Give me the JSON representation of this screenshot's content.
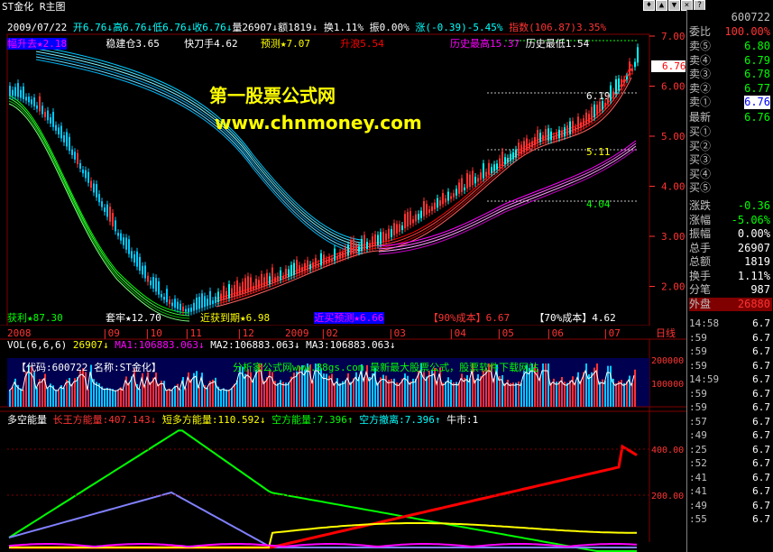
{
  "window": {
    "title": "ST金化  R主图",
    "controls": [
      "♦",
      "▲",
      "▼",
      "×",
      "?"
    ]
  },
  "quote_line": {
    "date": "2009/07/22",
    "open": "开6.76↓",
    "high": "高6.76↓",
    "low": "低6.76↓",
    "close": "收6.76↓",
    "vol": "量26907↓",
    "amount": "额1819↓",
    "turnover": "换1.11%",
    "amplitude": "振0.00%",
    "change": "涨(-0.39)-5.45%",
    "index": "指数(106.87)3.35%"
  },
  "indicator_line": {
    "a": "稳建仓3.65",
    "b": "快刀手4.62",
    "c": "预测★7.07",
    "d": "升浪5.54",
    "e": "历史最高15.37",
    "f": "历史最低1.54",
    "left": "幅升去★2.18"
  },
  "watermark": {
    "line1": "第一股票公式网",
    "line2": "www.chnmoney.com"
  },
  "price_marks": {
    "m1": "6.19",
    "m2": "5.11",
    "m3": "4.04"
  },
  "price_axis": [
    "7.00",
    "6.00",
    "5.00",
    "4.00",
    "3.00",
    "2.00"
  ],
  "current_price_tag": "6.76",
  "bottom_legend": {
    "a": "获利★87.30",
    "b": "套牢★12.70",
    "c": "近获到期★6.98",
    "d": "近买预测★6.66",
    "e": "【90%成本】6.67",
    "f": "【70%成本】4.62"
  },
  "date_axis": {
    "labels": [
      "2008",
      "|09",
      "|10",
      "|11",
      "|12",
      "2009",
      "|02",
      "|03",
      "|04",
      "|05",
      "|06",
      "|07"
    ],
    "period": "日线"
  },
  "vol_panel": {
    "title": "VOL(6,6,6)",
    "v": "26907↓",
    "ma1": "MA1:106883.063↓",
    "ma2": "MA2:106883.063↓",
    "ma3": "MA3:106883.063↓",
    "code_text": "【代码:600722 名称:ST金化】",
    "banner": "分析家公式网www.88gs.com 最新最大股票公式，股票软件下载网站",
    "axis": [
      "200000",
      "100000"
    ]
  },
  "energy_panel": {
    "title": "多空能量",
    "long": "长王方能量:407.143↓",
    "short_many": "短多方能量:110.592↓",
    "empty": "空方能量:7.396↑",
    "empty_exit": "空方撤离:7.396↑",
    "bull": "牛市:1",
    "axis": [
      "400.00",
      "200.00"
    ]
  },
  "right_panel": {
    "code": "600722",
    "row_wei": {
      "label": "委比",
      "value": "100.00%"
    },
    "sells": [
      {
        "label": "卖⑤",
        "value": "6.80"
      },
      {
        "label": "卖④",
        "value": "6.79"
      },
      {
        "label": "卖③",
        "value": "6.78"
      },
      {
        "label": "卖②",
        "value": "6.77"
      },
      {
        "label": "卖①",
        "value": "6.76"
      }
    ],
    "latest": {
      "label": "最新",
      "value": "6.76"
    },
    "buys": [
      {
        "label": "买①",
        "value": ""
      },
      {
        "label": "买②",
        "value": ""
      },
      {
        "label": "买③",
        "value": ""
      },
      {
        "label": "买④",
        "value": ""
      },
      {
        "label": "买⑤",
        "value": ""
      }
    ],
    "stats": [
      {
        "label": "涨跌",
        "value": "-0.36"
      },
      {
        "label": "涨幅",
        "value": "-5.06%"
      },
      {
        "label": "振幅",
        "value": "0.00%"
      },
      {
        "label": "总手",
        "value": "26907"
      },
      {
        "label": "总额",
        "value": "1819"
      },
      {
        "label": "换手",
        "value": "1.11%"
      },
      {
        "label": "分笔",
        "value": "987"
      },
      {
        "label": "外盘",
        "value": "26880"
      }
    ],
    "ticks": [
      {
        "t": "14:58",
        "v": "6.7"
      },
      {
        "t": ":59",
        "v": "6.7"
      },
      {
        "t": ":59",
        "v": "6.7"
      },
      {
        "t": ":59",
        "v": "6.7"
      },
      {
        "t": "14:59",
        "v": "6.7"
      },
      {
        "t": ":59",
        "v": "6.7"
      },
      {
        "t": ":59",
        "v": "6.7"
      },
      {
        "t": ":57",
        "v": "6.7"
      },
      {
        "t": ":49",
        "v": "6.7"
      },
      {
        "t": ":25",
        "v": "6.7"
      },
      {
        "t": ":52",
        "v": "6.7"
      },
      {
        "t": ":41",
        "v": "6.7"
      },
      {
        "t": ":41",
        "v": "6.7"
      },
      {
        "t": ":49",
        "v": "6.7"
      },
      {
        "t": ":55",
        "v": "6.7"
      }
    ]
  },
  "colors": {
    "red": "#ff0000",
    "green": "#00ff00",
    "cyan": "#00ffff",
    "magenta": "#ff00ff",
    "yellow": "#ffff00",
    "panel_blue": "#000080",
    "grid": "#800000"
  }
}
